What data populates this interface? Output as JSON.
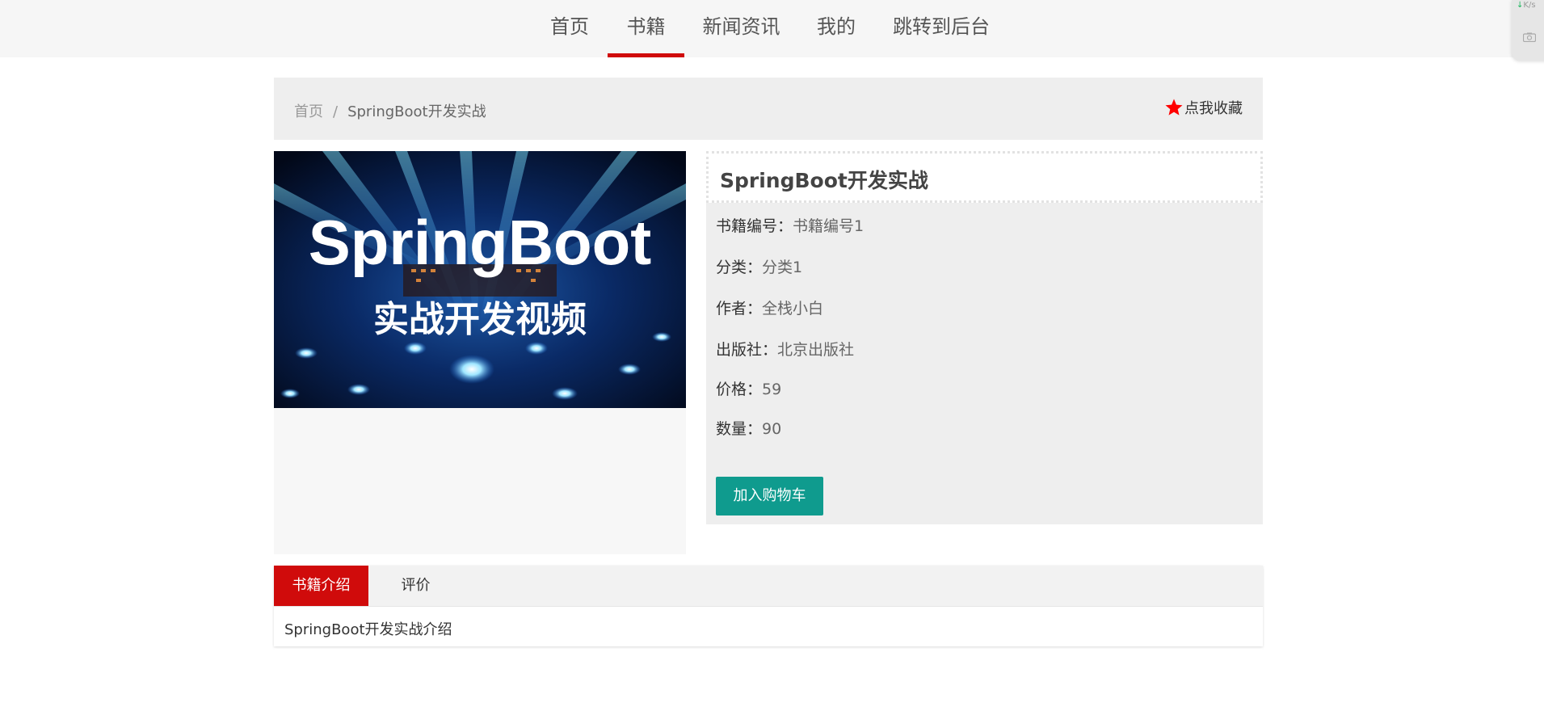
{
  "nav": {
    "items": [
      {
        "label": "首页"
      },
      {
        "label": "书籍"
      },
      {
        "label": "新闻资讯"
      },
      {
        "label": "我的"
      },
      {
        "label": "跳转到后台"
      }
    ],
    "active": "书籍"
  },
  "widget": {
    "speed": "K/s",
    "speed_icon": "down-arrow-icon",
    "icon": "camera-icon"
  },
  "breadcrumb": {
    "home": "首页",
    "separator": "/",
    "current": "SpringBoot开发实战"
  },
  "favorite": {
    "label": "点我收藏",
    "icon": "star-icon",
    "icon_color": "#ff0000"
  },
  "cover": {
    "line1": "SpringBoot",
    "line2": "实战开发视频"
  },
  "book": {
    "title": "SpringBoot开发实战",
    "fields": [
      {
        "label": "书籍编号：",
        "value": "书籍编号1"
      },
      {
        "label": "分类：",
        "value": "分类1"
      },
      {
        "label": "作者：",
        "value": "全栈小白"
      },
      {
        "label": "出版社：",
        "value": "北京出版社"
      },
      {
        "label": "价格：",
        "value": "59"
      },
      {
        "label": "数量：",
        "value": "90"
      }
    ],
    "cart_button": "加入购物车"
  },
  "tabs": {
    "items": [
      {
        "label": "书籍介绍"
      },
      {
        "label": "评价"
      }
    ],
    "active": "书籍介绍",
    "content": "SpringBoot开发实战介绍"
  },
  "colors": {
    "accent_red": "#d00b0b",
    "button_teal": "#0f9b8e",
    "star_red": "#ff0000"
  }
}
